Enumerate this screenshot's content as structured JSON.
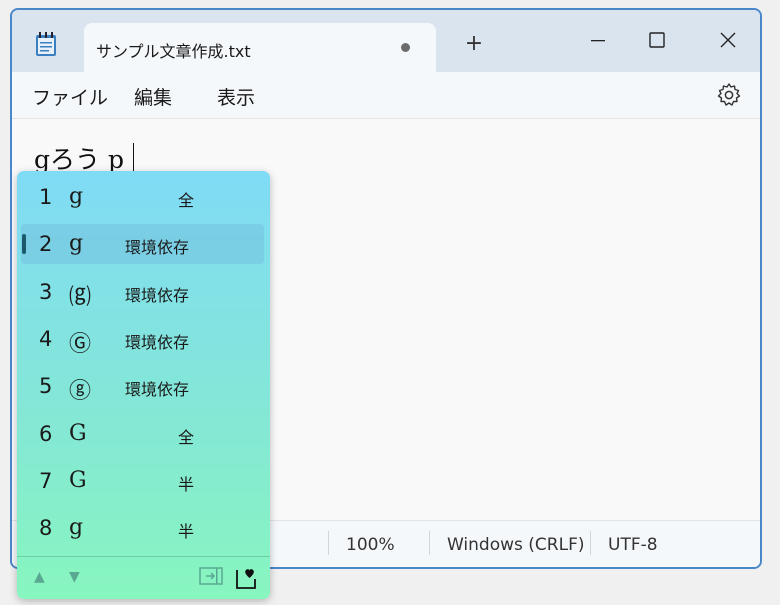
{
  "window": {
    "tab_title": "サンプル文章作成.txt"
  },
  "menu": {
    "file": "ファイル",
    "edit": "編集",
    "view": "表示"
  },
  "editor": {
    "text": "gろう p"
  },
  "status": {
    "zoom": "100%",
    "line_ending": "Windows (CRLF)",
    "encoding": "UTF-8"
  },
  "candidates": [
    {
      "num": "1",
      "char": "g",
      "note": "全"
    },
    {
      "num": "2",
      "char": "g",
      "note": "環境依存"
    },
    {
      "num": "3",
      "char": "⒢",
      "note": "環境依存"
    },
    {
      "num": "4",
      "char": "Ⓖ",
      "note": "環境依存"
    },
    {
      "num": "5",
      "char": "ⓖ",
      "note": "環境依存"
    },
    {
      "num": "6",
      "char": "G",
      "note": "全"
    },
    {
      "num": "7",
      "char": "G",
      "note": "半"
    },
    {
      "num": "8",
      "char": "g",
      "note": "半"
    }
  ],
  "selected_index": 2,
  "icons": [
    "notepad-icon",
    "new-tab-icon",
    "minimize-icon",
    "maximize-icon",
    "close-icon",
    "gear-icon",
    "up-arrow-icon",
    "down-arrow-icon",
    "expand-icon",
    "heart-icon"
  ]
}
